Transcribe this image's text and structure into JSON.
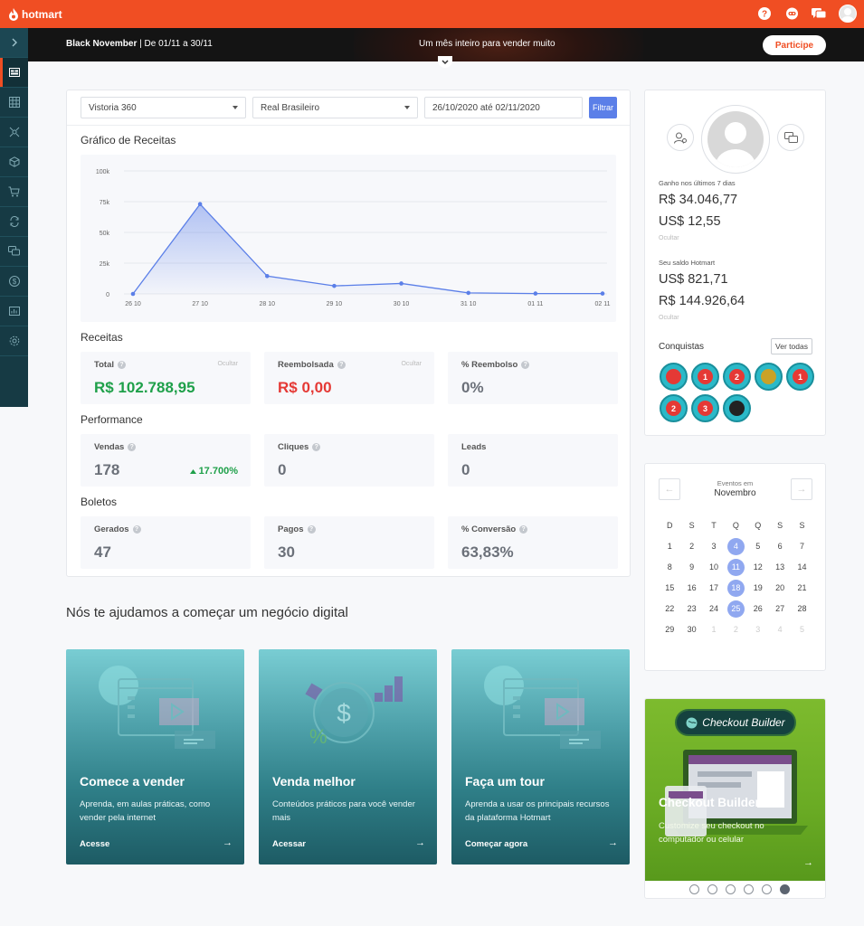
{
  "brand": {
    "name": "hotmart",
    "color": "#f04e23"
  },
  "topbar": {
    "icons": [
      "help-icon",
      "support-icon",
      "chat-icon",
      "user-avatar"
    ]
  },
  "banner": {
    "title_bold": "Black November",
    "title_rest": " | De 01/11 a 30/11",
    "center": "Um mês inteiro para vender muito",
    "button": "Participe"
  },
  "sidebar": {
    "items": [
      "expand-icon",
      "dashboard-icon",
      "grid-icon",
      "network-icon",
      "box-icon",
      "cart-icon",
      "sync-icon",
      "chat-icon",
      "dollar-icon",
      "chart-icon",
      "gear-icon"
    ]
  },
  "filters": {
    "product": "Vistoria 360",
    "currency": "Real Brasileiro",
    "date_range": "26/10/2020 até 02/11/2020",
    "button": "Filtrar"
  },
  "chart_section_title": "Gráfico de Receitas",
  "chart_data": {
    "type": "area",
    "x": [
      "26 10",
      "27 10",
      "28 10",
      "29 10",
      "30 10",
      "31 10",
      "01 11",
      "02 11"
    ],
    "series": [
      {
        "values": [
          0,
          73000,
          14500,
          6500,
          8500,
          800,
          300,
          300
        ]
      }
    ],
    "y_ticks": [
      "0",
      "25k",
      "50k",
      "75k",
      "100k"
    ],
    "ylim": [
      0,
      100000
    ],
    "grid": true,
    "color": "#5b7fe8"
  },
  "receitas": {
    "title": "Receitas",
    "total_label": "Total",
    "total_value": "R$ 102.788,95",
    "total_hide": "Ocultar",
    "reembolsada_label": "Reembolsada",
    "reembolsada_value": "R$ 0,00",
    "reembolsada_hide": "Ocultar",
    "pct_label": "% Reembolso",
    "pct_value": "0%"
  },
  "performance": {
    "title": "Performance",
    "vendas_label": "Vendas",
    "vendas_value": "178",
    "vendas_change": "17.700%",
    "cliques_label": "Cliques",
    "cliques_value": "0",
    "leads_label": "Leads",
    "leads_value": "0"
  },
  "boletos": {
    "title": "Boletos",
    "gerados_label": "Gerados",
    "gerados_value": "47",
    "pagos_label": "Pagos",
    "pagos_value": "30",
    "conv_label": "% Conversão",
    "conv_value": "63,83%"
  },
  "help_section": {
    "title": "Nós te ajudamos a começar um negócio digital",
    "cards": [
      {
        "title": "Comece a vender",
        "desc": "Aprenda, em aulas práticas, como vender pela internet",
        "link": "Acesse"
      },
      {
        "title": "Venda melhor",
        "desc": "Conteúdos práticos para você vender mais",
        "link": "Acessar"
      },
      {
        "title": "Faça um tour",
        "desc": "Aprenda a usar os principais recursos da plataforma Hotmart",
        "link": "Começar agora"
      }
    ]
  },
  "profile": {
    "earned_label": "Ganho nos últimos 7 dias",
    "earned_brl": "R$ 34.046,77",
    "earned_usd": "US$ 12,55",
    "earned_hide": "Ocultar",
    "balance_label": "Seu saldo Hotmart",
    "balance_usd": "US$ 821,71",
    "balance_brl": "R$ 144.926,64",
    "balance_hide": "Ocultar",
    "achievements_title": "Conquistas",
    "see_all": "Ver todas",
    "badges": [
      {
        "text": "",
        "core": "#e53935"
      },
      {
        "text": "1",
        "core": "#e53935"
      },
      {
        "text": "2",
        "core": "#e53935"
      },
      {
        "text": "",
        "core": "#c9a227"
      },
      {
        "text": "1",
        "core": "#e53935"
      },
      {
        "text": "2",
        "core": "#e53935"
      },
      {
        "text": "3",
        "core": "#e53935"
      },
      {
        "text": "",
        "core": "#222222"
      }
    ]
  },
  "calendar": {
    "subtitle": "Eventos em",
    "month": "Novembro",
    "weekdays": [
      "D",
      "S",
      "T",
      "Q",
      "Q",
      "S",
      "S"
    ],
    "days": [
      [
        "1",
        "2",
        "3",
        "4",
        "5",
        "6",
        "7"
      ],
      [
        "8",
        "9",
        "10",
        "11",
        "12",
        "13",
        "14"
      ],
      [
        "15",
        "16",
        "17",
        "18",
        "19",
        "20",
        "21"
      ],
      [
        "22",
        "23",
        "24",
        "25",
        "26",
        "27",
        "28"
      ],
      [
        "29",
        "30",
        "1",
        "2",
        "3",
        "4",
        "5"
      ]
    ],
    "event_days": [
      "4",
      "11",
      "18",
      "25"
    ]
  },
  "checkout_builder": {
    "pill": "Checkout Builder",
    "title": "Checkout Builder",
    "desc": "Customize seu checkout no computador ou celular",
    "dots": 6,
    "active_dot": 5
  }
}
